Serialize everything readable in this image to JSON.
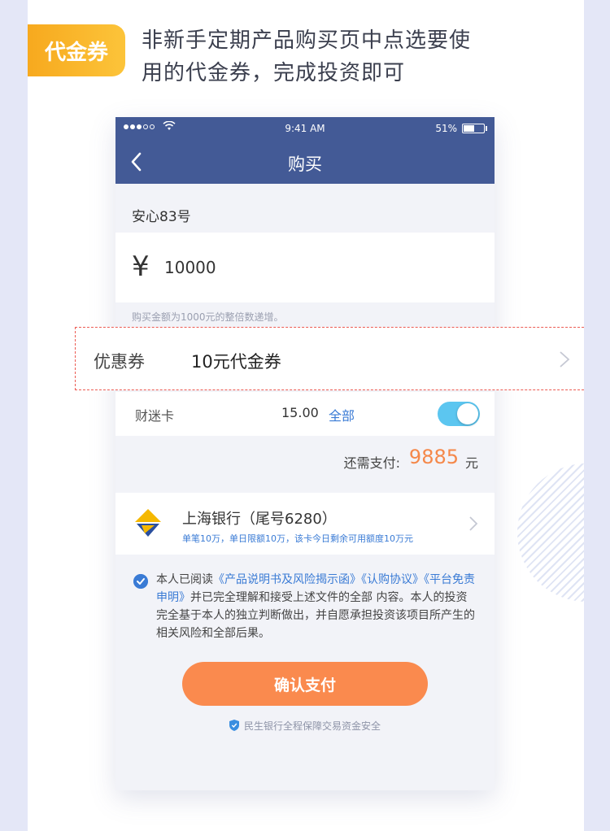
{
  "intro": {
    "tag": "代金券",
    "headline": "非新手定期产品购买页中点选要使用的代金券，完成投资即可"
  },
  "statusbar": {
    "time": "9:41 AM",
    "battery": "51%"
  },
  "navbar": {
    "title": "购买"
  },
  "product": {
    "name": "安心83号",
    "currency": "¥",
    "amount": "10000",
    "hint": "购买金额为1000元的整倍数递增。"
  },
  "coupon": {
    "label": "优惠券",
    "value": "10元代金券"
  },
  "card": {
    "label": "财迷卡",
    "balance": "15.00",
    "all_label": "全部",
    "enabled": true
  },
  "payment": {
    "label": "还需支付:",
    "amount": "9885",
    "unit": "元"
  },
  "bank": {
    "name": "上海银行（尾号6280）",
    "limit": "单笔10万，单日限额10万，该卡今日剩余可用额度10万元"
  },
  "agreement": {
    "prefix": "本人已阅读",
    "doc1": "《产品说明书及风险揭示函》",
    "doc2": "《认购协议》",
    "doc3": "《平台免责申明》",
    "suffix": "并已完全理解和接受上述文件的全部 内容。本人的投资完全基于本人的独立判断做出，并自愿承担投资该项目所产生的相关风险和全部后果。"
  },
  "confirm_button": "确认支付",
  "security_note": "民生银行全程保障交易资金安全",
  "colors": {
    "nav": "#435a96",
    "accent_orange": "#fa8a4e",
    "link_blue": "#3a7bd5",
    "toggle": "#5cc6f0",
    "tag_gradient": [
      "#f7a91e",
      "#fcc43a"
    ],
    "highlight_border": "#ec5b52"
  }
}
